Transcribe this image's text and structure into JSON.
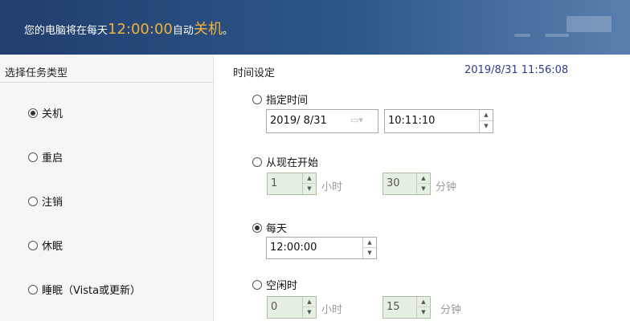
{
  "banner": {
    "prefix": "您的电脑将在每天",
    "time": "12:00:00",
    "middle": "自动",
    "action": "关机",
    "suffix": "。"
  },
  "left": {
    "header": "选择任务类型",
    "options": [
      {
        "label": "关机",
        "selected": true
      },
      {
        "label": "重启",
        "selected": false
      },
      {
        "label": "注销",
        "selected": false
      },
      {
        "label": "休眠",
        "selected": false
      },
      {
        "label": "睡眠（Vista或更新）",
        "selected": false
      }
    ]
  },
  "right": {
    "header": "时间设定",
    "current_datetime": "2019/8/31 11:56:08",
    "specified": {
      "label": "指定时间",
      "selected": false,
      "date": "2019/  8/31",
      "time": "10:11:10"
    },
    "from_now": {
      "label": "从现在开始",
      "selected": false,
      "hours": "1",
      "hours_unit": "小时",
      "minutes": "30",
      "minutes_unit": "分钟"
    },
    "daily": {
      "label": "每天",
      "selected": true,
      "time": "12:00:00"
    },
    "idle": {
      "label": "空闲时",
      "selected": false,
      "hours": "0",
      "hours_unit": "小时",
      "minutes": "15",
      "minutes_unit": "分钟"
    }
  },
  "icons": {
    "spin_up": "▲",
    "spin_down": "▼",
    "calendar": "▭▾"
  },
  "colors": {
    "banner": "#2d5689",
    "highlight": "#f0b23a",
    "disabled_field": "#e6f0e2",
    "timestamp": "#2a3e8c"
  }
}
